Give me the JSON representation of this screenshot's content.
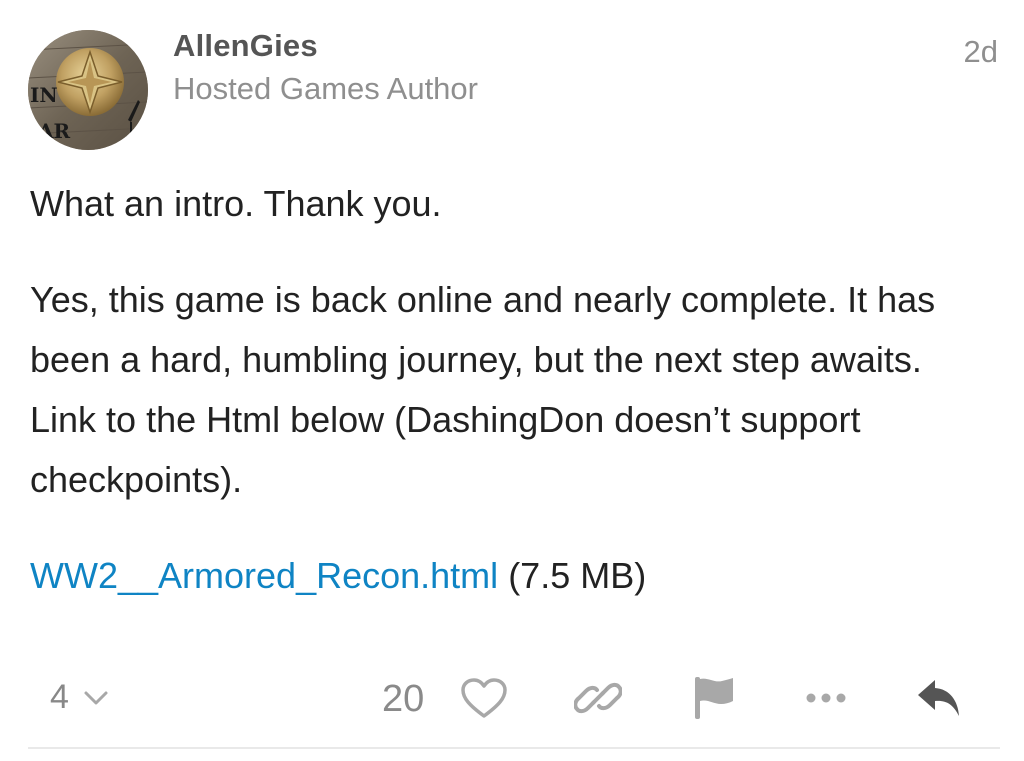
{
  "author": {
    "username": "AllenGies",
    "title": "Hosted Games Author",
    "avatar_icon": "compass-star-avatar",
    "avatar_text_top": "IN",
    "avatar_text_bottom": "AR"
  },
  "post": {
    "date": "2d",
    "paragraph_1": "What an intro. Thank you.",
    "paragraph_2": "Yes, this game is back online and nearly complete. It has been a hard, humbling journey, but the next step awaits. Link to the Html below (DashingDon doesn’t support checkpoints).",
    "attachment": {
      "name": "WW2__Armored_Recon.html",
      "size": "(7.5 MB)"
    }
  },
  "actions": {
    "reply_count": "4",
    "like_count": "20",
    "icons": {
      "expand": "chevron-down-icon",
      "like": "heart-icon",
      "link": "link-icon",
      "flag": "flag-icon",
      "more": "ellipsis-icon",
      "reply": "reply-arrow-icon"
    }
  },
  "colors": {
    "link": "#0f84c4",
    "muted": "#8f8f8f",
    "icon": "#a8a8a8",
    "text": "#222222"
  }
}
